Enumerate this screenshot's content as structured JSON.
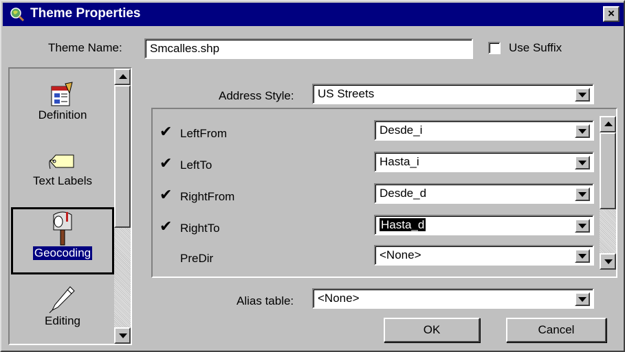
{
  "window": {
    "title": "Theme Properties",
    "close_label": "×"
  },
  "theme_name": {
    "label": "Theme Name:",
    "value": "Smcalles.shp"
  },
  "use_suffix": {
    "label": "Use Suffix",
    "checked": false
  },
  "nav": {
    "items": [
      {
        "label": "Definition",
        "icon": "definition-icon",
        "selected": false
      },
      {
        "label": "Text Labels",
        "icon": "tag-icon",
        "selected": false
      },
      {
        "label": "Geocoding",
        "icon": "mailbox-icon",
        "selected": true
      },
      {
        "label": "Editing",
        "icon": "pen-icon",
        "selected": false
      }
    ]
  },
  "address_style": {
    "label": "Address Style:",
    "value": "US Streets"
  },
  "fields": [
    {
      "name": "LeftFrom",
      "checked": true,
      "value": "Desde_i"
    },
    {
      "name": "LeftTo",
      "checked": true,
      "value": "Hasta_i"
    },
    {
      "name": "RightFrom",
      "checked": true,
      "value": "Desde_d"
    },
    {
      "name": "RightTo",
      "checked": true,
      "value": "Hasta_d"
    },
    {
      "name": "PreDir",
      "checked": false,
      "value": "<None>"
    }
  ],
  "alias_table": {
    "label": "Alias table:",
    "value": "<None>"
  },
  "buttons": {
    "ok": "OK",
    "cancel": "Cancel"
  },
  "colors": {
    "titlebar": "#000080",
    "face": "#c0c0c0",
    "highlight": "#000080"
  }
}
